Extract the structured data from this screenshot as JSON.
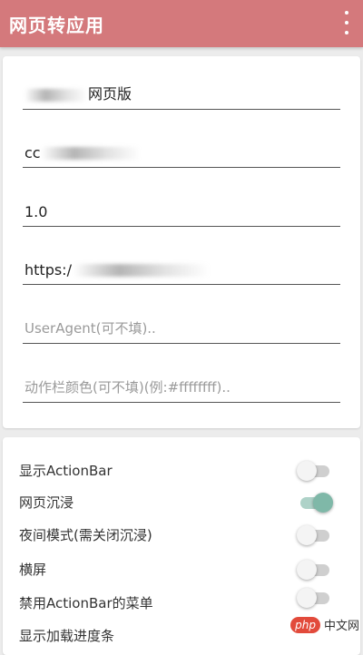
{
  "app_bar": {
    "title": "网页转应用",
    "overflow_icon": "more-vert-icon",
    "color": "#d4797c"
  },
  "form": {
    "name_field": {
      "value": "网页版"
    },
    "package_field": {
      "value": "cc"
    },
    "version_field": {
      "value": "1.0"
    },
    "url_field": {
      "value": "https:/"
    },
    "useragent_field": {
      "placeholder": "UserAgent(可不填)..",
      "value": ""
    },
    "actionbar_color_field": {
      "placeholder": "动作栏颜色(可不填)(例:#ffffffff)..",
      "value": ""
    }
  },
  "settings": {
    "items": [
      {
        "label": "显示ActionBar",
        "on": false
      },
      {
        "label": "网页沉浸",
        "on": true
      },
      {
        "label": "夜间模式(需关闭沉浸)",
        "on": false
      },
      {
        "label": "横屏",
        "on": false
      },
      {
        "label": "禁用ActionBar的菜单",
        "on": false
      },
      {
        "label": "显示加载进度条",
        "on": false
      }
    ],
    "accent_color": "#7fb8a8"
  },
  "watermark": {
    "badge": "php",
    "site": "中文网"
  }
}
